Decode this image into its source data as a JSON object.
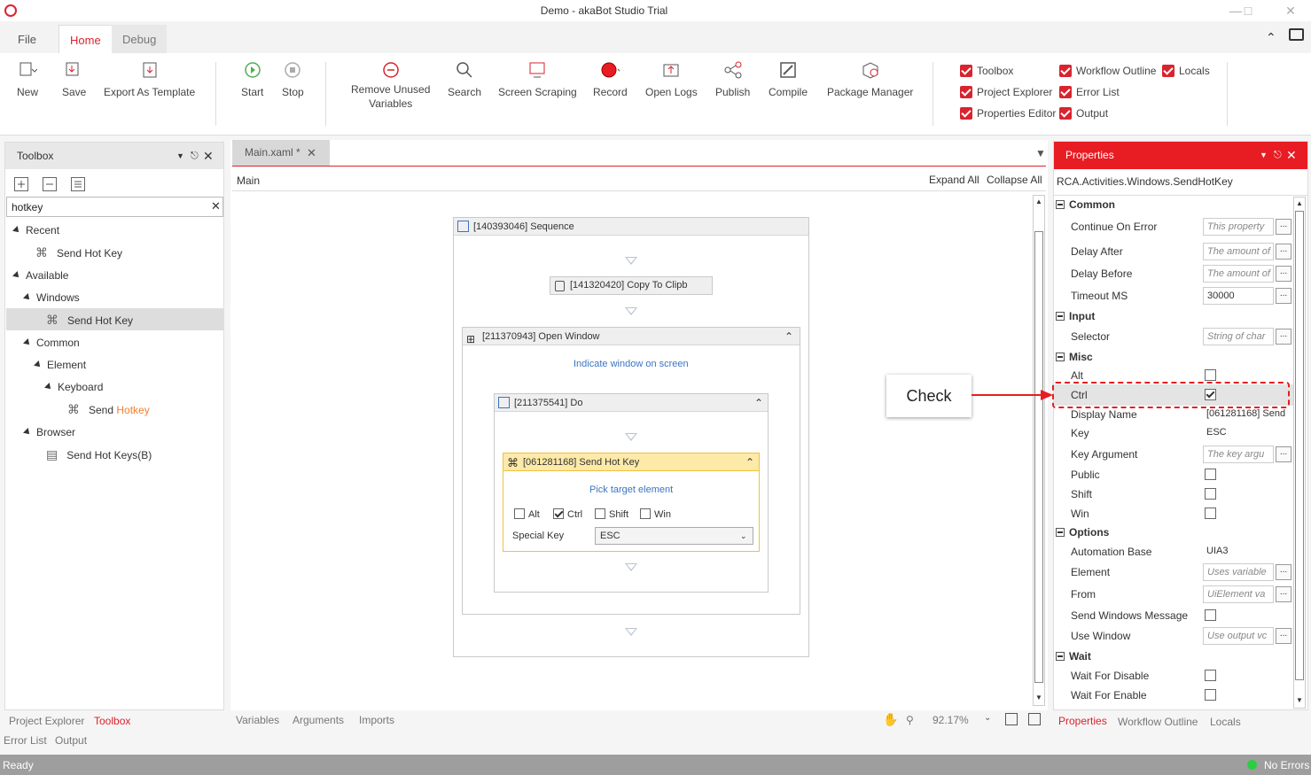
{
  "window": {
    "title": "Demo - akaBot Studio Trial"
  },
  "tabs": [
    "File",
    "Home",
    "Debug"
  ],
  "ribbon": {
    "buttons": [
      "New",
      "Save",
      "Export As Template",
      "Start",
      "Stop",
      "Remove Unused",
      "Variables",
      "Search",
      "Screen Scraping",
      "Record",
      "Open Logs",
      "Publish",
      "Compile",
      "Package Manager"
    ],
    "checks": [
      "Toolbox",
      "Project Explorer",
      "Properties Editor",
      "Workflow Outline",
      "Error List",
      "Output",
      "Locals"
    ]
  },
  "toolbox": {
    "title": "Toolbox",
    "search_value": "hotkey",
    "tree": [
      "Recent",
      "Send Hot Key",
      "Available",
      "Windows",
      "Send Hot Key",
      "Common",
      "Element",
      "Keyboard",
      "Send ",
      "Hotkey",
      "Browser",
      "Send Hot Keys(B)"
    ]
  },
  "designer": {
    "tab": "Main.xaml *",
    "breadcrumb": "Main",
    "expand_all": "Expand All",
    "collapse_all": "Collapse All",
    "sequence": "[140393046] Sequence",
    "copy": "[141320420] Copy To Clipb",
    "open_window": "[211370943] Open Window",
    "indicate": "Indicate window on screen",
    "do": "[211375541] Do",
    "send_hot_key": "[061281168] Send Hot Key",
    "pick": "Pick target element",
    "mods": [
      "Alt",
      "Ctrl",
      "Shift",
      "Win"
    ],
    "special_key_label": "Special Key",
    "special_key_value": "ESC",
    "bottom_tabs": [
      "Variables",
      "Arguments",
      "Imports"
    ],
    "zoom": "92.17%"
  },
  "callout": {
    "text": "Check"
  },
  "properties": {
    "title": "Properties",
    "type": "RCA.Activities.Windows.SendHotKey",
    "categories": [
      "Common",
      "Input",
      "Misc",
      "Options",
      "Wait"
    ],
    "rows": {
      "continue_on_error": [
        "Continue On Error",
        "This property"
      ],
      "delay_after": [
        "Delay After",
        "The amount of"
      ],
      "delay_before": [
        "Delay Before",
        "The amount of"
      ],
      "timeout": [
        "Timeout MS",
        "30000"
      ],
      "selector": [
        "Selector",
        "String of char"
      ],
      "alt": "Alt",
      "ctrl": "Ctrl",
      "display_name": [
        "Display Name",
        "[061281168] Send"
      ],
      "key": [
        "Key",
        "ESC"
      ],
      "key_argument": [
        "Key Argument",
        "The key argu"
      ],
      "public": "Public",
      "shift": "Shift",
      "win": "Win",
      "automation_base": [
        "Automation Base",
        "UIA3"
      ],
      "element": [
        "Element",
        "Uses variable"
      ],
      "from": [
        "From",
        "UiElement va"
      ],
      "send_windows_message": "Send Windows Message",
      "use_window": [
        "Use Window",
        "Use output vc"
      ],
      "wait_for_disable": "Wait For Disable",
      "wait_for_enable": "Wait For Enable"
    },
    "bottom_tabs": [
      "Properties",
      "Workflow Outline",
      "Locals"
    ]
  },
  "left_bottom_tabs": [
    "Project Explorer",
    "Toolbox",
    "Error List",
    "Output"
  ],
  "status": {
    "left": "Ready",
    "right": "No Errors"
  },
  "colors": {
    "accent": "#d9232e",
    "link": "#3c74c2",
    "callout": "#e81c23"
  }
}
